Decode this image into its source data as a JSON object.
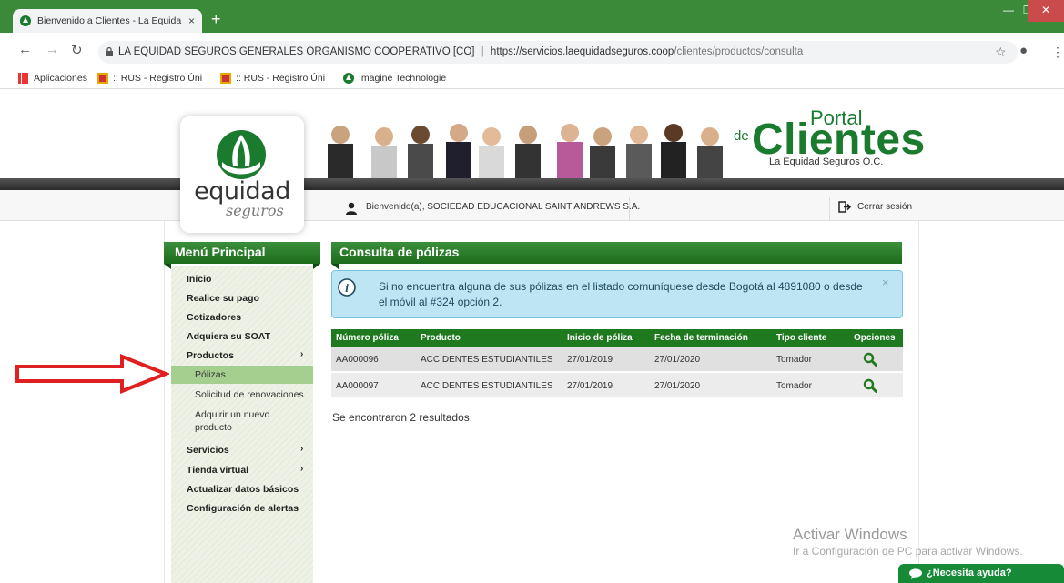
{
  "browser": {
    "tab_title": "Bienvenido a Clientes - La Equida",
    "new_tab": "+",
    "tab_close": "×",
    "url_host": "LA EQUIDAD SEGUROS GENERALES ORGANISMO COOPERATIVO [CO]",
    "url_sep": "|",
    "url_scheme_host": "https://servicios.laequidadseguros.coop",
    "url_path": "/clientes/productos/consulta",
    "bookmarks": [
      {
        "label": "Aplicaciones"
      },
      {
        "label": ":: RUS - Registro Úni"
      },
      {
        "label": ":: RUS - Registro Úni"
      },
      {
        "label": "Imagine Technologie"
      }
    ]
  },
  "header": {
    "logo_main": "equidad",
    "logo_sub": "seguros",
    "portal_de": "de",
    "portal_word": "Portal",
    "portal_big": "Clientes",
    "portal_sub": "La Equidad Seguros O.C.",
    "welcome": "Bienvenido(a), SOCIEDAD EDUCACIONAL SAINT ANDREWS S.A.",
    "logout": "Cerrar sesión"
  },
  "sidebar": {
    "title": "Menú Principal",
    "items": [
      {
        "label": "Inicio"
      },
      {
        "label": "Realice su pago"
      },
      {
        "label": "Cotizadores"
      },
      {
        "label": "Adquiera su SOAT"
      },
      {
        "label": "Productos",
        "chevron": "›"
      },
      {
        "label": "Servicios",
        "chevron": "›"
      },
      {
        "label": "Tienda virtual",
        "chevron": "›"
      },
      {
        "label": "Actualizar datos básicos"
      },
      {
        "label": "Configuración de alertas"
      }
    ],
    "subitems": [
      {
        "label": "Pólizas",
        "active": true
      },
      {
        "label": "Solicitud de renovaciones"
      },
      {
        "label": "Adquirir un nuevo producto"
      }
    ]
  },
  "main": {
    "title": "Consulta de pólizas",
    "alert": "Si no encuentra alguna de sus pólizas en el listado comuníquese desde Bogotá al 4891080 o desde el móvil al #324 opción 2.",
    "alert_close": "×",
    "table": {
      "headers": [
        "Número póliza",
        "Producto",
        "Inicio de póliza",
        "Fecha de terminación",
        "Tipo cliente",
        "Opciones"
      ],
      "rows": [
        [
          "AA000096",
          "ACCIDENTES ESTUDIANTILES",
          "27/01/2019",
          "27/01/2020",
          "Tomador"
        ],
        [
          "AA000097",
          "ACCIDENTES ESTUDIANTILES",
          "27/01/2019",
          "27/01/2020",
          "Tomador"
        ]
      ]
    },
    "results": "Se encontraron 2 resultados."
  },
  "watermark": {
    "line1": "Activar Windows",
    "line2": "Ir a Configuración de PC para activar Windows."
  },
  "help": {
    "label": "¿Necesita ayuda?"
  },
  "colors": {
    "brand_green": "#1f7a1f",
    "alert_bg": "#bee5f3",
    "arrow_red": "#e02020"
  }
}
